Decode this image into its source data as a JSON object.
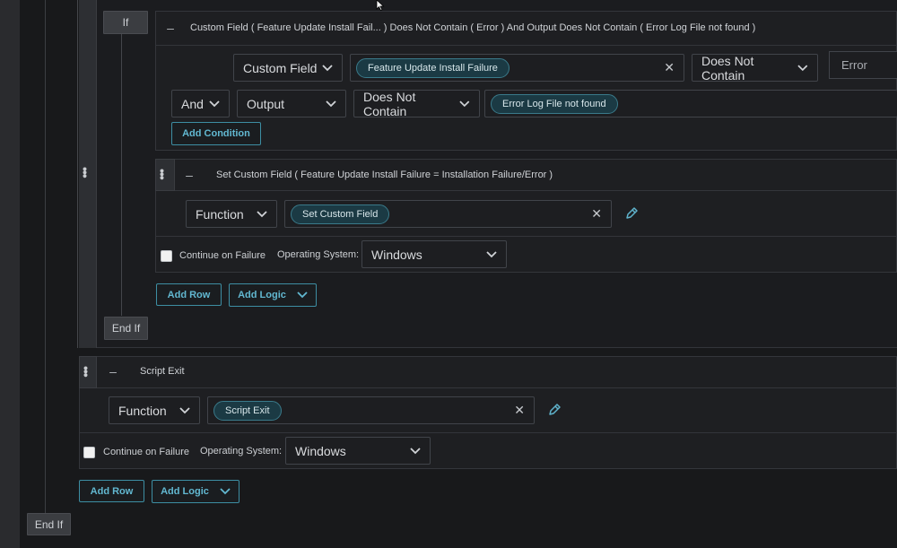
{
  "outer": {
    "end_if_label": "End If"
  },
  "if_block": {
    "if_label": "If",
    "end_if_label": "End If",
    "condition_header": "Custom Field ( Feature Update Install Fail...  ) Does Not Contain ( Error ) And Output Does Not Contain ( Error Log File not found )",
    "row1": {
      "field_select": "Custom Field",
      "field_chip": "Feature Update Install Failure",
      "operator_select": "Does Not Contain",
      "value_input": "Error"
    },
    "row2": {
      "join_select": "And",
      "field_select": "Output",
      "operator_select": "Does Not Contain",
      "value_chip": "Error Log File not found"
    },
    "add_condition_label": "Add Condition",
    "action": {
      "header": "Set Custom Field ( Feature Update Install Failure = Installation Failure/Error )",
      "type_select": "Function",
      "function_chip": "Set Custom Field",
      "continue_label": "Continue on Failure",
      "os_label": "Operating System:",
      "os_select": "Windows"
    },
    "add_row_label": "Add Row",
    "add_logic_label": "Add Logic"
  },
  "script_exit": {
    "header": "Script Exit",
    "type_select": "Function",
    "function_chip": "Script Exit",
    "continue_label": "Continue on Failure",
    "os_label": "Operating System:",
    "os_select": "Windows",
    "add_row_label": "Add Row",
    "add_logic_label": "Add Logic"
  },
  "icons": {
    "drag": "drag-handle-icon",
    "collapse": "minus-icon",
    "chevron": "chevron-down-icon",
    "clear": "close-icon",
    "edit": "pencil-icon",
    "cursor": "mouse-cursor-icon"
  },
  "colors": {
    "background": "#18191b",
    "accent": "#62b8d1",
    "chip_bg": "#1b3a44"
  }
}
